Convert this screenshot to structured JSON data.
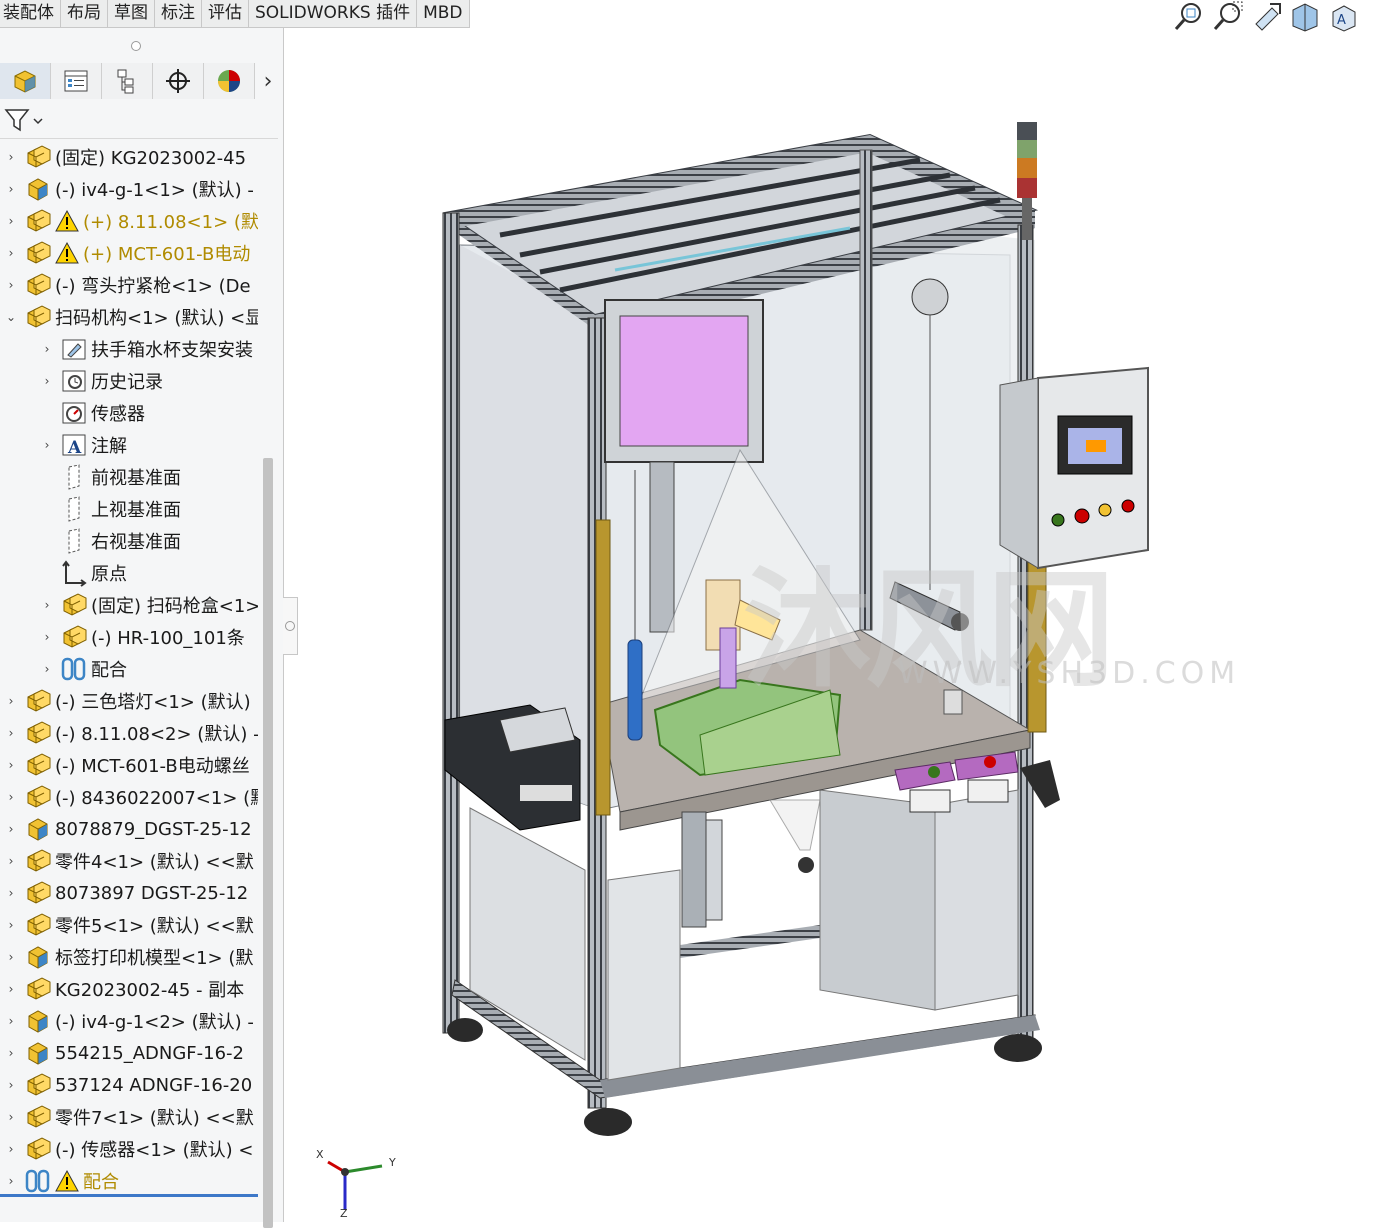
{
  "tabs": [
    "装配体",
    "布局",
    "草图",
    "标注",
    "评估",
    "SOLIDWORKS 插件",
    "MBD"
  ],
  "manager_tabs": [
    {
      "icon": "feature-manager-icon",
      "active": true
    },
    {
      "icon": "property-manager-icon"
    },
    {
      "icon": "configuration-manager-icon"
    },
    {
      "icon": "dimxpert-manager-icon"
    },
    {
      "icon": "display-manager-icon"
    }
  ],
  "manager_more": "›",
  "filter_icon": "filter-icon",
  "tree": [
    {
      "caret": "›",
      "icon": "assembly-icon",
      "label": "(固定) KG2023002-45"
    },
    {
      "caret": "›",
      "icon": "part-icon",
      "label": "(-) iv4-g-1<1> (默认) -"
    },
    {
      "caret": "›",
      "icon": "assembly-icon",
      "warn": true,
      "yellow": true,
      "label": "(+) 8.11.08<1> (默"
    },
    {
      "caret": "›",
      "icon": "assembly-icon",
      "warn": true,
      "yellow": true,
      "label": "(+) MCT-601-B电动"
    },
    {
      "caret": "›",
      "icon": "assembly-icon",
      "label": "(-) 弯头拧紧枪<1> (De"
    },
    {
      "caret": "⌄",
      "icon": "assembly-icon",
      "label": "扫码机构<1> (默认) <显"
    },
    {
      "caret": "›",
      "icon": "folder-icon",
      "label": "扶手箱水杯支架安装",
      "indent": 1
    },
    {
      "caret": "›",
      "icon": "history-icon",
      "label": "历史记录",
      "indent": 1
    },
    {
      "caret": "",
      "icon": "sensor-icon",
      "label": "传感器",
      "indent": 1
    },
    {
      "caret": "›",
      "icon": "annotation-icon",
      "label": "注解",
      "indent": 1
    },
    {
      "caret": "",
      "icon": "plane-icon",
      "label": "前视基准面",
      "indent": 1
    },
    {
      "caret": "",
      "icon": "plane-icon",
      "label": "上视基准面",
      "indent": 1
    },
    {
      "caret": "",
      "icon": "plane-icon",
      "label": "右视基准面",
      "indent": 1
    },
    {
      "caret": "",
      "icon": "origin-icon",
      "label": "原点",
      "indent": 1
    },
    {
      "caret": "›",
      "icon": "assembly-icon",
      "label": "(固定) 扫码枪盒<1>",
      "indent": 1
    },
    {
      "caret": "›",
      "icon": "assembly-icon",
      "label": "(-) HR-100_101条",
      "indent": 1
    },
    {
      "caret": "›",
      "icon": "mates-icon",
      "label": "配合",
      "indent": 1
    },
    {
      "caret": "›",
      "icon": "assembly-icon",
      "label": "(-) 三色塔灯<1> (默认)"
    },
    {
      "caret": "›",
      "icon": "assembly-icon",
      "label": "(-) 8.11.08<2> (默认) -"
    },
    {
      "caret": "›",
      "icon": "assembly-icon",
      "label": "(-) MCT-601-B电动螺丝"
    },
    {
      "caret": "›",
      "icon": "assembly-icon",
      "label": "(-) 8436022007<1> (默"
    },
    {
      "caret": "›",
      "icon": "part-icon",
      "label": "8078879_DGST-25-12"
    },
    {
      "caret": "›",
      "icon": "assembly-icon",
      "label": "零件4<1> (默认) <<默"
    },
    {
      "caret": "›",
      "icon": "assembly-icon",
      "label": "8073897 DGST-25-12"
    },
    {
      "caret": "›",
      "icon": "assembly-icon",
      "label": "零件5<1> (默认) <<默"
    },
    {
      "caret": "›",
      "icon": "part-icon",
      "label": "标签打印机模型<1> (默"
    },
    {
      "caret": "›",
      "icon": "assembly-icon",
      "label": "KG2023002-45 - 副本"
    },
    {
      "caret": "›",
      "icon": "part-icon",
      "label": "(-) iv4-g-1<2> (默认) -"
    },
    {
      "caret": "›",
      "icon": "part-icon",
      "label": "554215_ADNGF-16-2"
    },
    {
      "caret": "›",
      "icon": "assembly-icon",
      "label": "537124 ADNGF-16-20"
    },
    {
      "caret": "›",
      "icon": "assembly-icon",
      "label": "零件7<1> (默认) <<默"
    },
    {
      "caret": "›",
      "icon": "assembly-icon",
      "label": "(-) 传感器<1> (默认) <"
    },
    {
      "caret": "›",
      "icon": "mates-icon",
      "warn": true,
      "yellow": true,
      "label": "配合"
    }
  ],
  "heads_up_toolbar": [
    "zoom-to-fit-icon",
    "zoom-to-area-icon",
    "previous-view-icon",
    "section-view-icon",
    "view-orientation-icon"
  ],
  "watermark": {
    "cn": "沐风网",
    "url": "WWW.YSH3D.COM"
  },
  "triad": {
    "x": "X",
    "y": "Y",
    "z": "Z"
  },
  "colors": {
    "tree_text": "#1a1a1a",
    "warning_text": "#b08b00",
    "hmi_screen": "#e3a6f2",
    "fixture": "#93c47d"
  }
}
